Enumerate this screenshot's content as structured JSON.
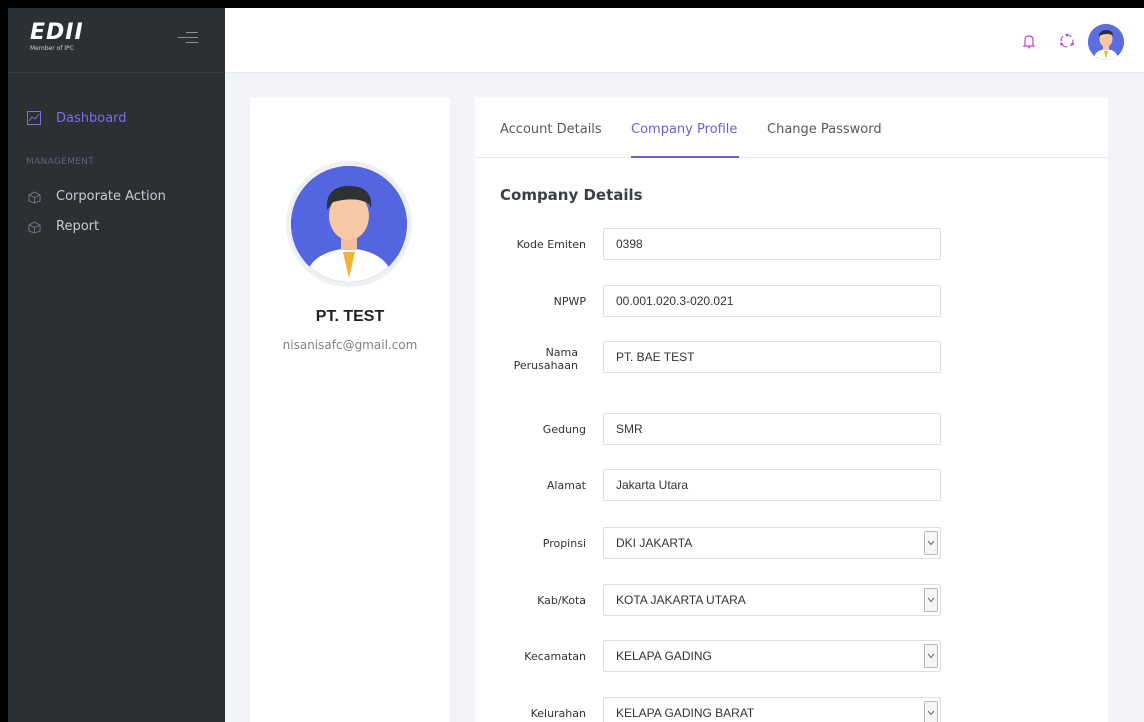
{
  "logo": {
    "mark": "EDII",
    "sub": "Member of IPC"
  },
  "sidebar": {
    "dashboard": "Dashboard",
    "section": "MANAGEMENT",
    "items": [
      {
        "label": "Corporate Action"
      },
      {
        "label": "Report"
      }
    ]
  },
  "profile": {
    "name": "PT. TEST",
    "email": "nisanisafc@gmail.com"
  },
  "tabs": [
    {
      "label": "Account Details"
    },
    {
      "label": "Company Profile"
    },
    {
      "label": "Change Password"
    }
  ],
  "form": {
    "title": "Company Details",
    "kode_emiten": {
      "label": "Kode Emiten",
      "value": "0398"
    },
    "npwp": {
      "label": "NPWP",
      "value": "00.001.020.3-020.021"
    },
    "nama": {
      "label": "Nama Perusahaan",
      "value": "PT. BAE TEST"
    },
    "gedung": {
      "label": "Gedung",
      "value": "SMR"
    },
    "alamat": {
      "label": "Alamat",
      "value": "Jakarta Utara"
    },
    "propinsi": {
      "label": "Propinsi",
      "value": "DKI JAKARTA"
    },
    "kabkota": {
      "label": "Kab/Kota",
      "value": "KOTA JAKARTA UTARA"
    },
    "kecamatan": {
      "label": "Kecamatan",
      "value": "KELAPA GADING"
    },
    "kelurahan": {
      "label": "Kelurahan",
      "value": "KELAPA GADING BARAT"
    }
  },
  "colors": {
    "accent": "#6b5fd8",
    "sidebar": "#2b3035",
    "avatar_bg": "#5465e0",
    "bell": "#c443c9"
  },
  "icons": {
    "topbar": [
      "bell-icon",
      "support-icon",
      "user-avatar"
    ]
  }
}
